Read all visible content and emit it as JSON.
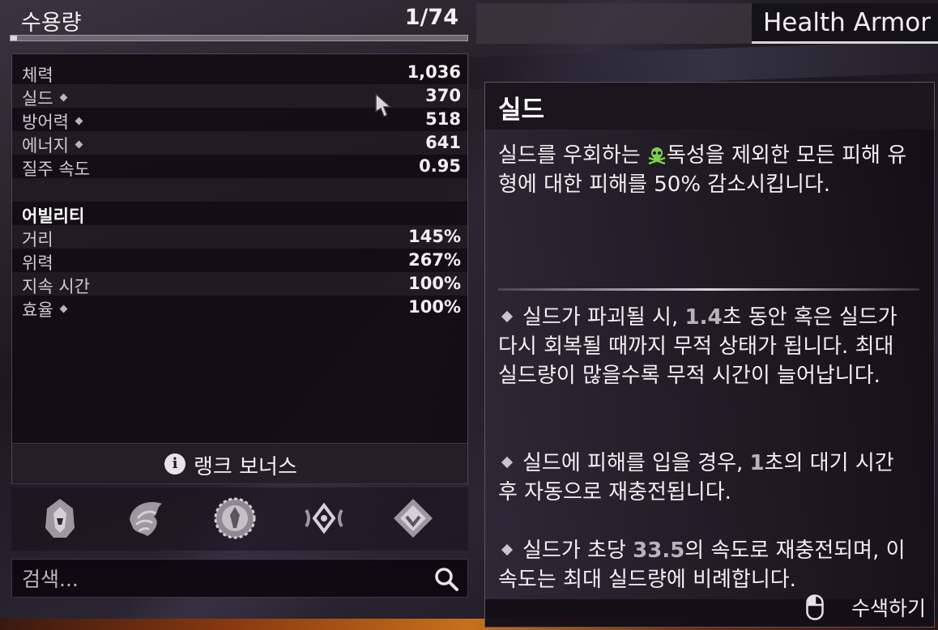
{
  "capacity": {
    "label": "수용량",
    "value": "1/74",
    "fill_fraction": 0.0135
  },
  "title_tab": "Health Armor",
  "stats": {
    "rows": [
      {
        "key": "체력",
        "value": "1,036",
        "mod": false
      },
      {
        "key": "실드",
        "value": "370",
        "mod": true
      },
      {
        "key": "방어력",
        "value": "518",
        "mod": true
      },
      {
        "key": "에너지",
        "value": "641",
        "mod": true
      },
      {
        "key": "질주 속도",
        "value": "0.95",
        "mod": false
      }
    ],
    "ability_heading": "어빌리티",
    "ability_rows": [
      {
        "key": "거리",
        "value": "145%",
        "mod": false
      },
      {
        "key": "위력",
        "value": "267%",
        "mod": false
      },
      {
        "key": "지속 시간",
        "value": "100%",
        "mod": false
      },
      {
        "key": "효율",
        "value": "100%",
        "mod": true
      }
    ],
    "rank_bonus": "랭크 보너스",
    "rank_icon": "i"
  },
  "search": {
    "placeholder": "검색..."
  },
  "icons": [
    "warframe-helmet-icon",
    "beast-crest-icon",
    "ornate-crest-icon",
    "eye-diamond-icon",
    "diamond-crest-icon"
  ],
  "tooltip": {
    "title": "실드",
    "desc_part1": "실드를 우회하는 ",
    "desc_toxin": "독성",
    "desc_part2": "을 제외한 모든 피해 유형에 대한 피해를 50% 감소시킵니다.",
    "b1_a": "실드가 파괴될 시, ",
    "b1_num": "1.4",
    "b1_b": "초 동안 혹은 실드가 다시 회복될 때까지 무적 상태가 됩니다. 최대 실드량이 많을수록 무적 시간이 늘어납니다.",
    "b2_a": "실드에 피해를 입을 경우, ",
    "b2_num": "1",
    "b2_b": "초의 대기 시간 후 자동으로 재충전됩니다.",
    "b3_a": "실드가 초당 ",
    "b3_num": "33.5",
    "b3_b": "의 속도로 재충전되며, 이 속도는 최대 실드량에 비례합니다.",
    "footer": "수색하기"
  },
  "colors": {
    "toxin": "#7bd24a",
    "accent_gray": "#b8b4bc"
  }
}
